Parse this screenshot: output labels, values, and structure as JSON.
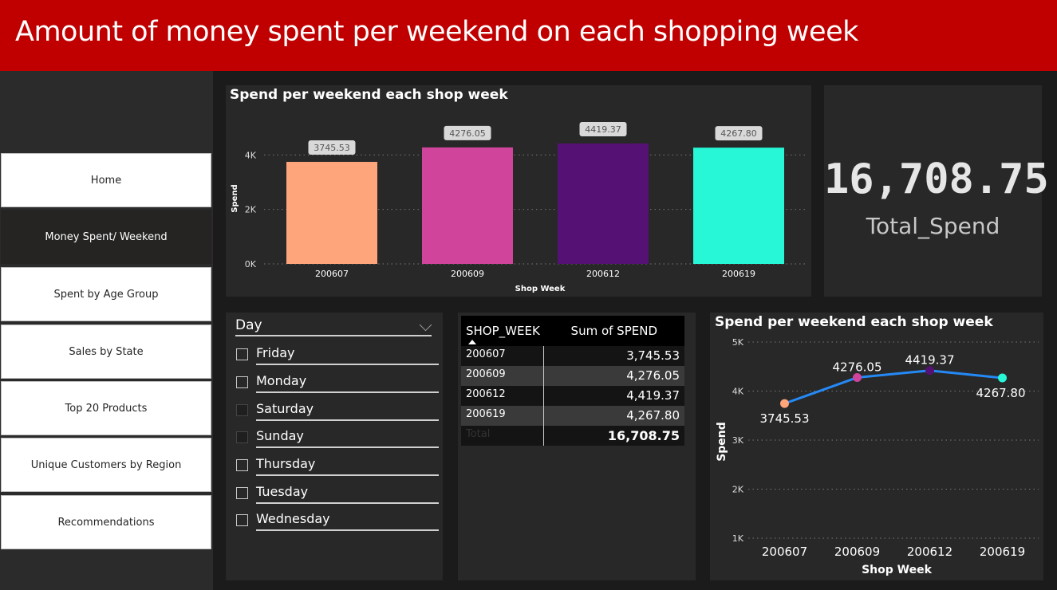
{
  "header": {
    "title": "Amount of money spent per weekend on each shopping week"
  },
  "nav": {
    "items": [
      {
        "label": "Home",
        "active": false
      },
      {
        "label": "Money Spent/ Weekend",
        "active": true
      },
      {
        "label": "Spent by Age Group",
        "active": false
      },
      {
        "label": "Sales by State",
        "active": false
      },
      {
        "label": "Top 20 Products",
        "active": false
      },
      {
        "label": "Unique Customers by Region",
        "active": false
      },
      {
        "label": "Recommendations",
        "active": false
      }
    ]
  },
  "kpi": {
    "value": "16,708.75",
    "label": "Total_Spend"
  },
  "slicer": {
    "title": "Day",
    "options": [
      {
        "label": "Friday",
        "enabled": true
      },
      {
        "label": "Monday",
        "enabled": true
      },
      {
        "label": "Saturday",
        "enabled": false
      },
      {
        "label": "Sunday",
        "enabled": false
      },
      {
        "label": "Thursday",
        "enabled": true
      },
      {
        "label": "Tuesday",
        "enabled": true
      },
      {
        "label": "Wednesday",
        "enabled": true
      }
    ]
  },
  "table": {
    "headers": [
      "SHOP_WEEK",
      "Sum of SPEND"
    ],
    "rows": [
      [
        "200607",
        "3,745.53"
      ],
      [
        "200609",
        "4,276.05"
      ],
      [
        "200612",
        "4,419.37"
      ],
      [
        "200619",
        "4,267.80"
      ]
    ],
    "total_label": "Total",
    "total_value": "16,708.75"
  },
  "colors": {
    "accent": "#c00000",
    "bar1": "#ffa57c",
    "bar2": "#d0449c",
    "bar3": "#561174",
    "bar4": "#27f6d7",
    "line": "#2589f5"
  },
  "chart_data": [
    {
      "type": "bar",
      "title": "Spend per weekend each shop week",
      "xlabel": "Shop Week",
      "ylabel": "Spend",
      "categories": [
        "200607",
        "200609",
        "200612",
        "200619"
      ],
      "values": [
        3745.53,
        4276.05,
        4419.37,
        4267.8
      ],
      "data_labels": [
        "3745.53",
        "4276.05",
        "4419.37",
        "4267.80"
      ],
      "yticks": [
        0,
        2000,
        4000
      ],
      "ytick_labels": [
        "0K",
        "2K",
        "4K"
      ],
      "ylim": [
        0,
        4800
      ],
      "grid": true
    },
    {
      "type": "line",
      "title": "Spend per weekend each shop week",
      "xlabel": "Shop Week",
      "ylabel": "Spend",
      "categories": [
        "200607",
        "200609",
        "200612",
        "200619"
      ],
      "values": [
        3745.53,
        4276.05,
        4419.37,
        4267.8
      ],
      "data_labels": [
        "3745.53",
        "4276.05",
        "4419.37",
        "4267.80"
      ],
      "yticks": [
        1000,
        2000,
        3000,
        4000,
        5000
      ],
      "ytick_labels": [
        "1K",
        "2K",
        "3K",
        "4K",
        "5K"
      ],
      "ylim": [
        1000,
        5000
      ],
      "grid": true
    }
  ]
}
